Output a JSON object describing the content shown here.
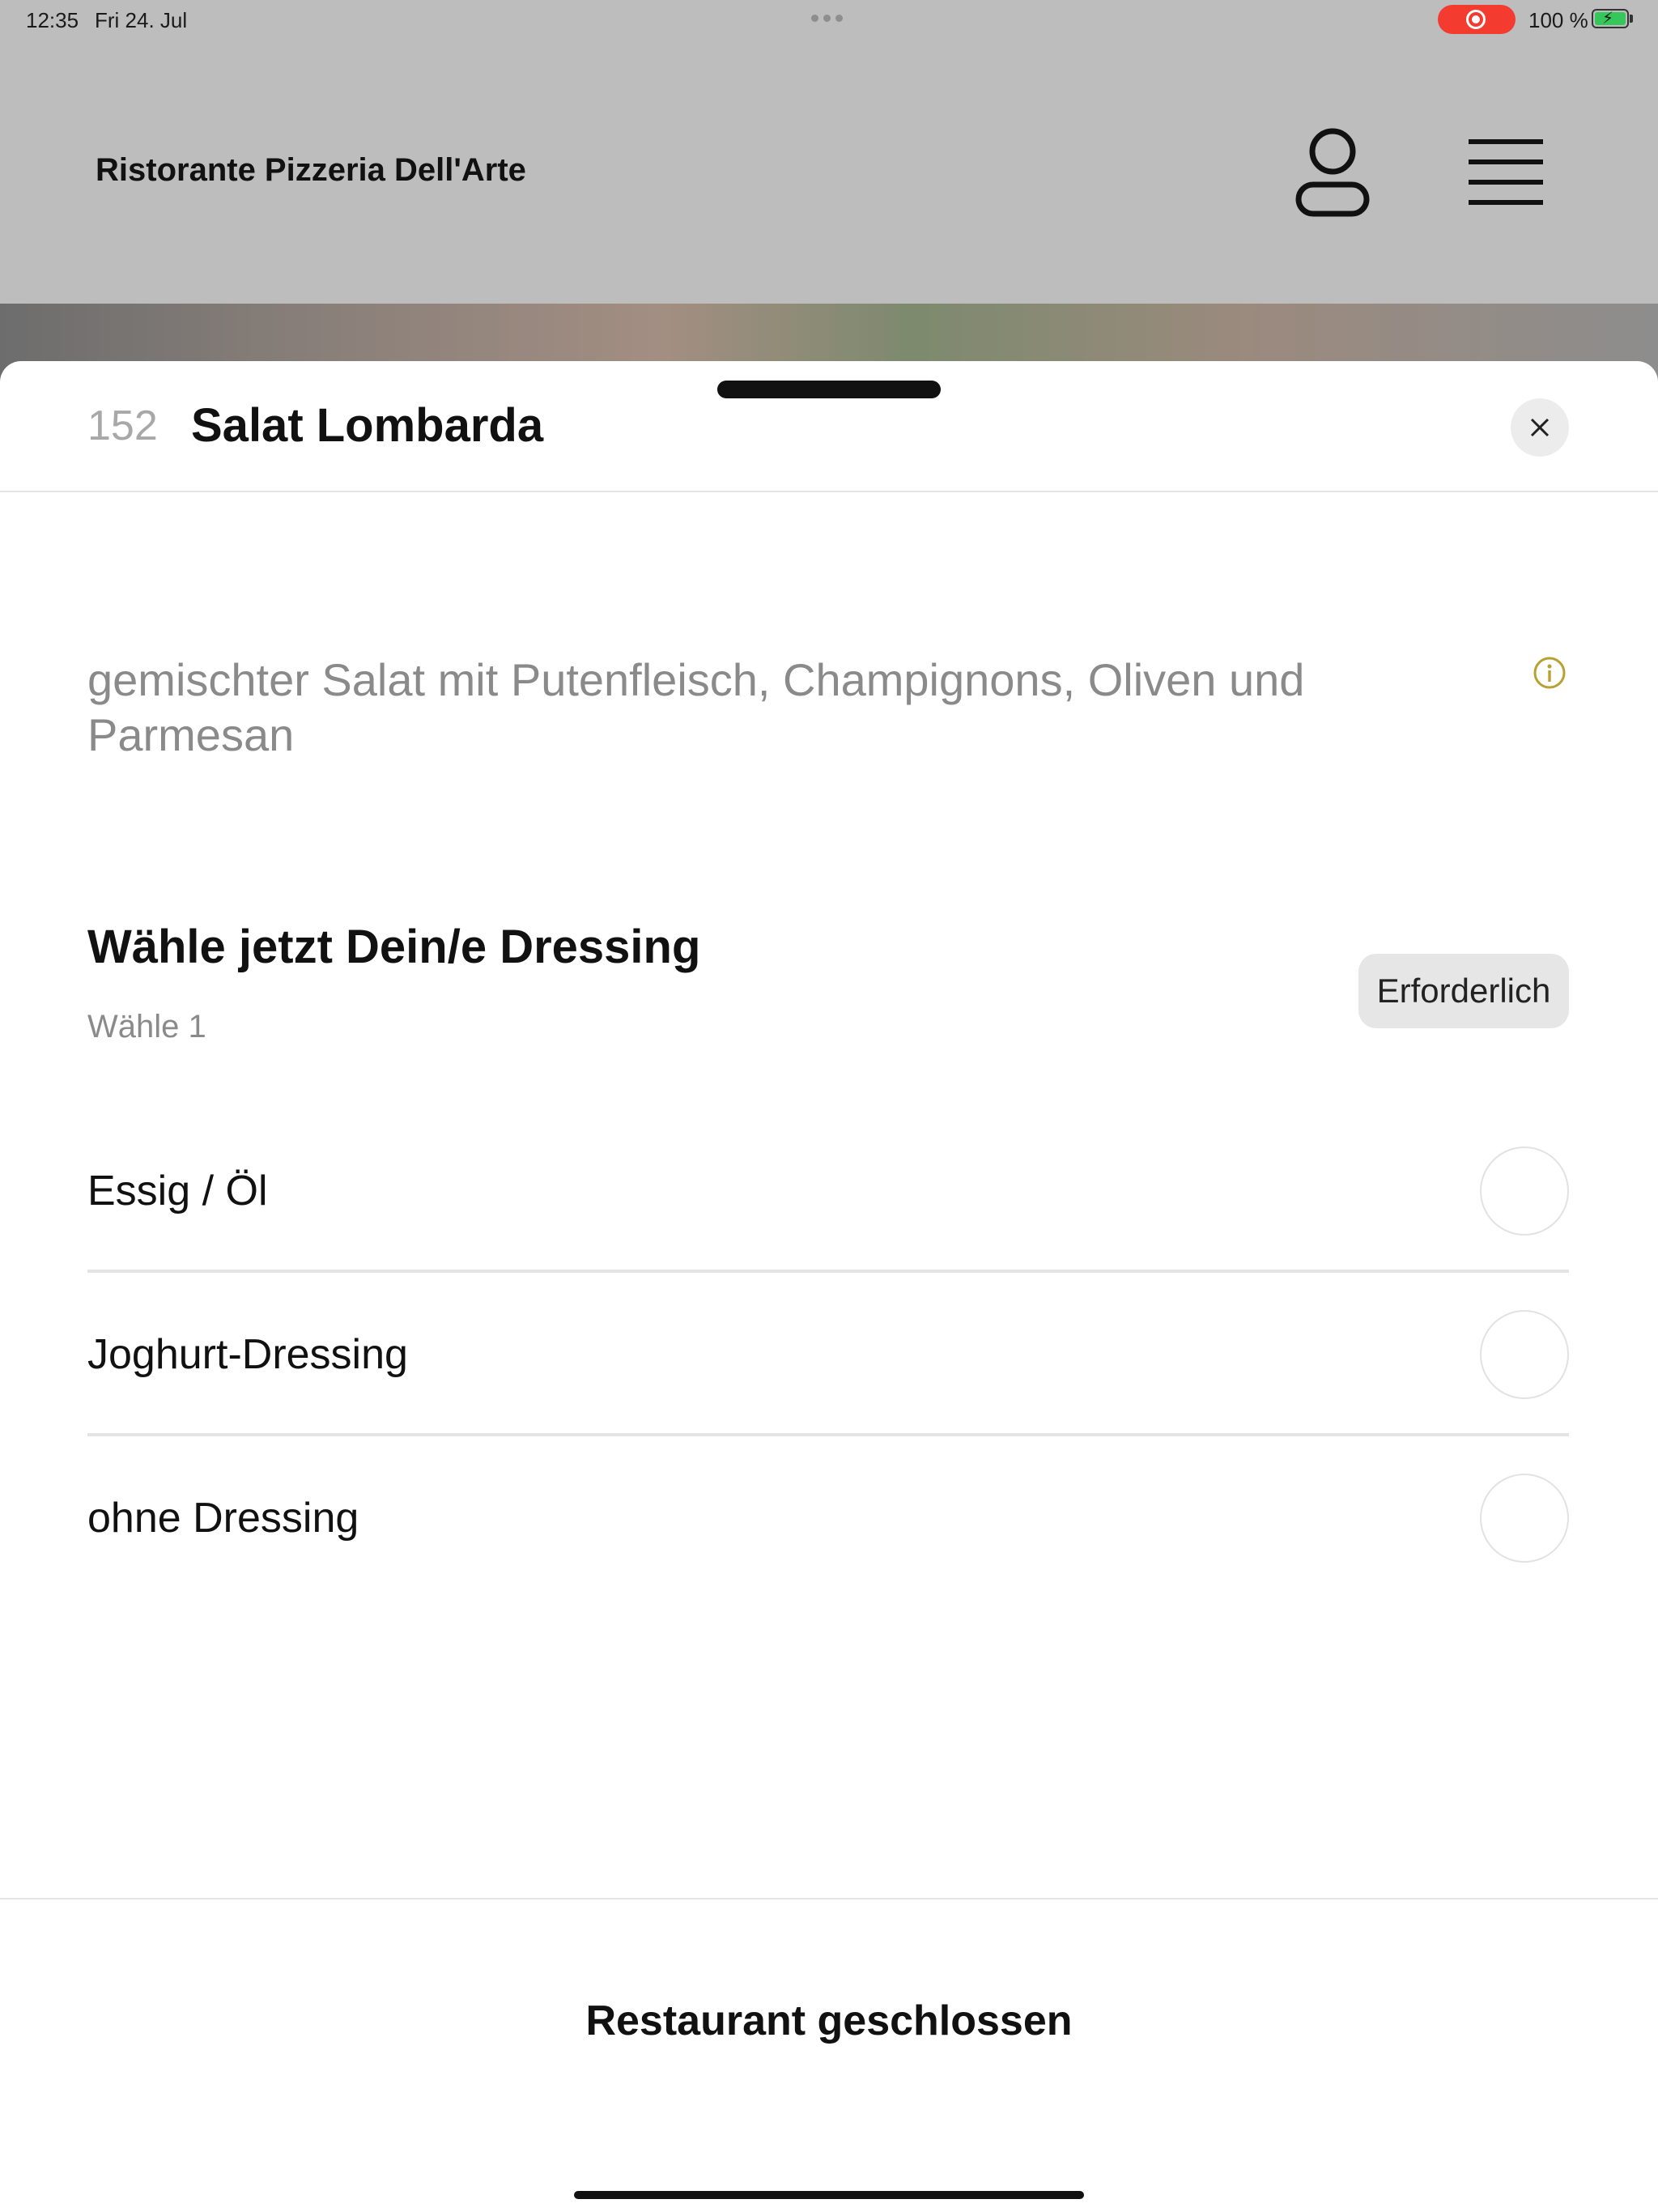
{
  "status_bar": {
    "time": "12:35",
    "date": "Fri 24. Jul",
    "battery": "100 %",
    "icons": [
      "screen-recording-icon",
      "battery-charging-icon"
    ]
  },
  "header": {
    "title": "Ristorante Pizzeria Dell'Arte",
    "icons": [
      "user-icon",
      "hamburger-menu-icon"
    ]
  },
  "item": {
    "number": "152",
    "name": "Salat Lombarda",
    "description": "gemischter Salat mit Putenfleisch, Champignons, Oliven und Parmesan"
  },
  "option_group": {
    "title": "Wähle jetzt Dein/e Dressing",
    "subtitle": "Wähle 1",
    "badge": "Erforderlich",
    "options": [
      {
        "label": "Essig / Öl",
        "selected": false
      },
      {
        "label": "Joghurt-Dressing",
        "selected": false
      },
      {
        "label": "ohne Dressing",
        "selected": false
      }
    ]
  },
  "footer": {
    "status": "Restaurant geschlossen"
  },
  "colors": {
    "backdrop": "#bdbdbd",
    "sheet": "#ffffff",
    "info_accent": "#b9a032",
    "recording": "#f43b30",
    "battery": "#35c759"
  }
}
